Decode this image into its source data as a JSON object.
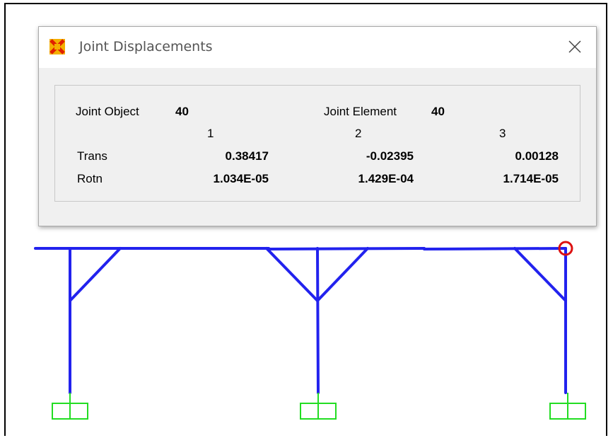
{
  "dialog": {
    "title": "Joint Displacements",
    "close_icon": "close-icon",
    "app_icon": "sap2000-icon",
    "joint_object_label": "Joint  Object",
    "joint_object_value": "40",
    "joint_element_label": "Joint Element",
    "joint_element_value": "40",
    "columns": [
      "1",
      "2",
      "3"
    ],
    "rows": [
      {
        "label": "Trans",
        "values": [
          "0.38417",
          "-0.02395",
          "0.00128"
        ]
      },
      {
        "label": "Rotn",
        "values": [
          "1.034E-05",
          "1.429E-04",
          "1.714E-05"
        ]
      }
    ]
  },
  "model": {
    "frame_color": "#2222ee",
    "support_color": "#22dd22",
    "selection_color": "#dd1111"
  }
}
